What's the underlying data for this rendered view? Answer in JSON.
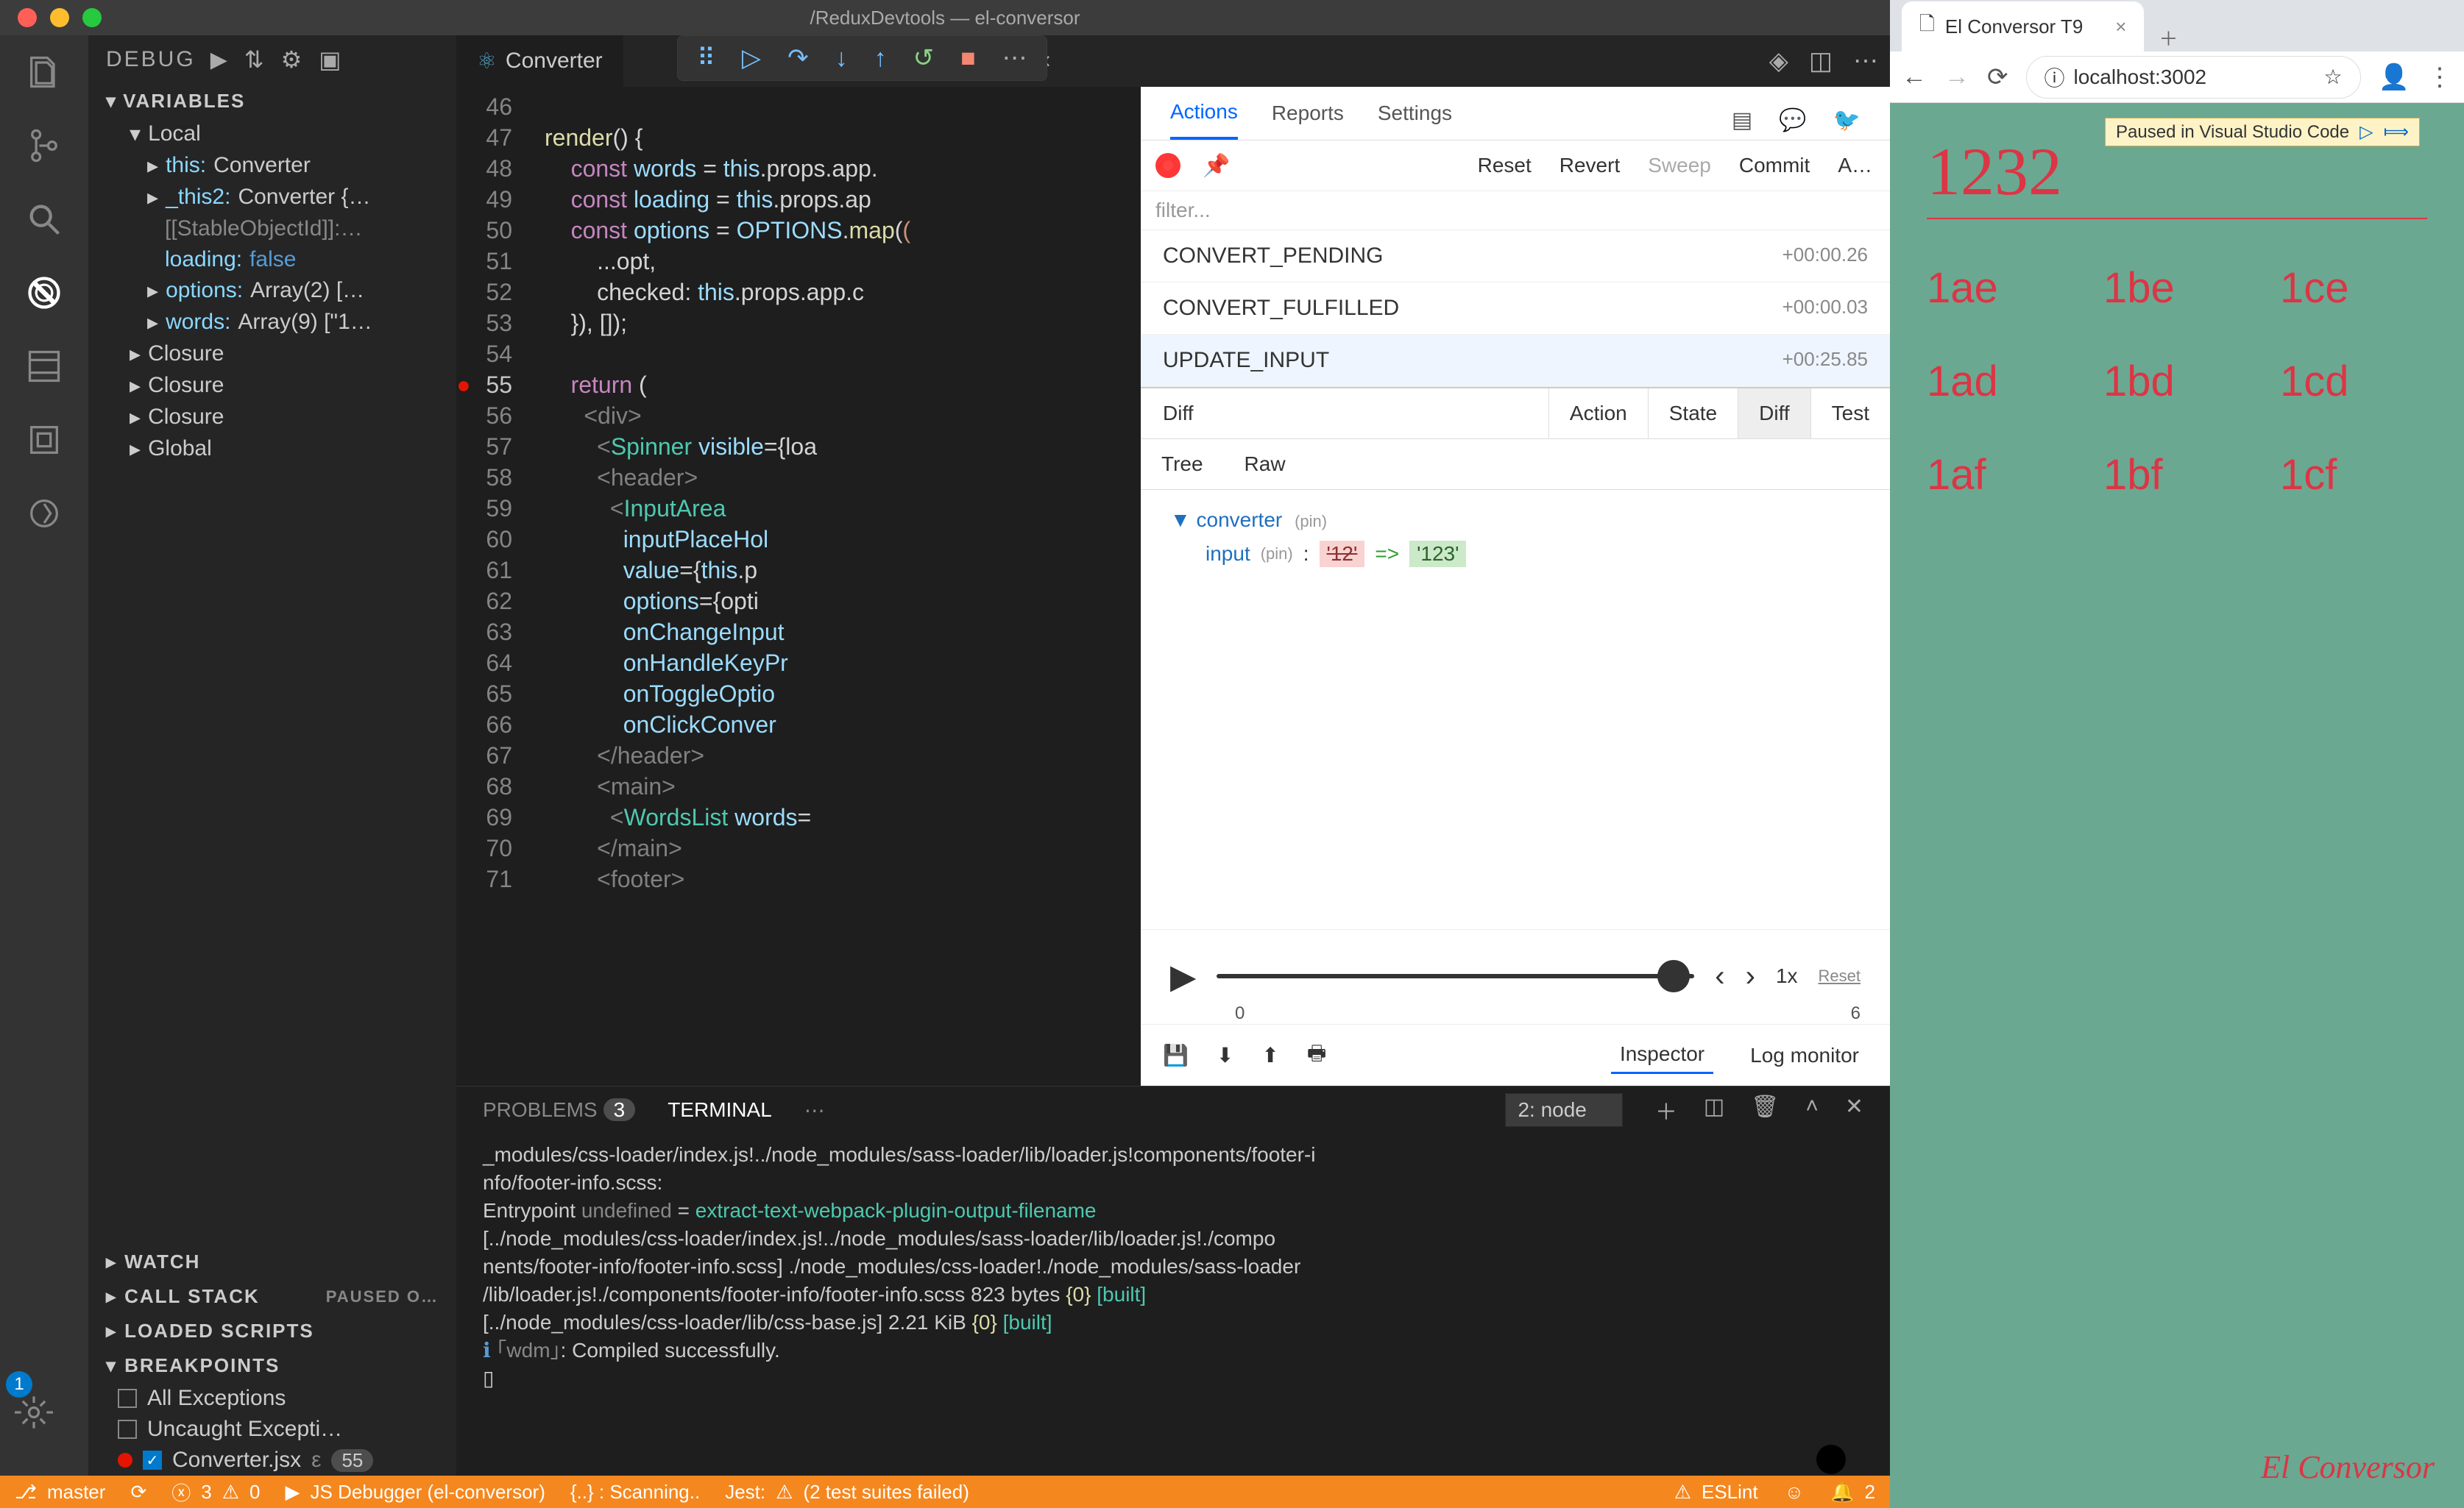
{
  "os": {
    "title": "/ReduxDevtools — el-conversor"
  },
  "sidebar": {
    "debug_label": "DEBUG",
    "sections": {
      "variables": "VARIABLES",
      "watch": "WATCH",
      "callstack": "CALL STACK",
      "callstack_status": "PAUSED O…",
      "loaded": "LOADED SCRIPTS",
      "breakpoints": "BREAKPOINTS"
    },
    "vars": {
      "local": "Local",
      "this": "this:",
      "this_v": "Converter",
      "this2": "_this2:",
      "this2_v": "Converter {…",
      "stable": "[[StableObjectId]]:…",
      "loading": "loading:",
      "loading_v": "false",
      "options": "options:",
      "options_v": "Array(2) […",
      "words": "words:",
      "words_v": "Array(9) [\"1…",
      "closure": "Closure",
      "global": "Global"
    },
    "bps": {
      "all": "All Exceptions",
      "uncaught": "Uncaught Excepti…",
      "file": "Converter.jsx",
      "line": "55"
    }
  },
  "tabs": {
    "converter": "Converter",
    "devtools": "/ReduxDevtools"
  },
  "code": {
    "lines": [
      "46",
      "47",
      "48",
      "49",
      "50",
      "51",
      "52",
      "53",
      "54",
      "55",
      "56",
      "57",
      "58",
      "59",
      "60",
      "61",
      "62",
      "63",
      "64",
      "65",
      "66",
      "67",
      "68",
      "69",
      "70",
      "71"
    ],
    "current": "55"
  },
  "devtools": {
    "tabs": {
      "actions": "Actions",
      "reports": "Reports",
      "settings": "Settings"
    },
    "ctrl": {
      "reset": "Reset",
      "revert": "Revert",
      "sweep": "Sweep",
      "commit": "Commit",
      "auto": "A…"
    },
    "filter_ph": "filter...",
    "actions": [
      {
        "name": "CONVERT_PENDING",
        "t": "+00:00.26"
      },
      {
        "name": "CONVERT_FULFILLED",
        "t": "+00:00.03"
      },
      {
        "name": "UPDATE_INPUT",
        "t": "+00:25.85"
      }
    ],
    "view": {
      "diff": "Diff",
      "action": "Action",
      "state": "State",
      "test": "Test"
    },
    "sub": {
      "tree": "Tree",
      "raw": "Raw"
    },
    "diff": {
      "root": "converter",
      "pin": "(pin)",
      "key": "input",
      "old": "'12'",
      "arrow": "=>",
      "new": "'123'"
    },
    "player": {
      "speed": "1x",
      "reset": "Reset",
      "t0": "0",
      "t1": "6"
    },
    "foot": {
      "inspector": "Inspector",
      "log": "Log monitor"
    }
  },
  "panel": {
    "problems": "PROBLEMS",
    "problems_n": "3",
    "terminal": "TERMINAL",
    "node": "2: node",
    "lines": [
      "_modules/css-loader/index.js!../node_modules/sass-loader/lib/loader.js!components/footer-i",
      "nfo/footer-info.scss:",
      "Entrypoint undefined = extract-text-webpack-plugin-output-filename",
      "   [../node_modules/css-loader/index.js!../node_modules/sass-loader/lib/loader.js!./compo",
      "nents/footer-info/footer-info.scss] ./node_modules/css-loader!./node_modules/sass-loader",
      "/lib/loader.js!./components/footer-info/footer-info.scss 823 bytes {0} [built]",
      "   [../node_modules/css-loader/lib/css-base.js] 2.21 KiB {0} [built]",
      "ℹ ｢wdm｣: Compiled successfully."
    ]
  },
  "status": {
    "branch": "master",
    "errors": "3",
    "warns": "0",
    "play": "",
    "debugger": "JS Debugger (el-conversor)",
    "scan": "{..} : Scanning..",
    "jest": "Jest:",
    "jest_t": "(2 test suites failed)",
    "eslint": "ESLint",
    "bell": "2"
  },
  "browser": {
    "tab": "El Conversor T9",
    "url": "localhost:3002",
    "paused": "Paused in Visual Studio Code",
    "display": "1232",
    "cells": [
      "1ae",
      "1be",
      "1ce",
      "1ad",
      "1bd",
      "1cd",
      "1af",
      "1bf",
      "1cf"
    ],
    "brand": "El Conversor"
  }
}
